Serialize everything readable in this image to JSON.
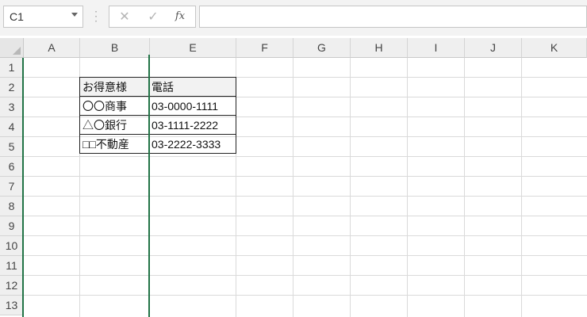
{
  "formula_bar": {
    "name_box": "C1",
    "cancel_icon": "✕",
    "enter_icon": "✓",
    "fx_label": "fx",
    "formula": ""
  },
  "columns": [
    "A",
    "B",
    "E",
    "F",
    "G",
    "H",
    "I",
    "J",
    "K"
  ],
  "rows": [
    "1",
    "2",
    "3",
    "4",
    "5",
    "6",
    "7",
    "8",
    "9",
    "10",
    "11",
    "12",
    "13"
  ],
  "table": {
    "header": [
      "お得意様",
      "電話"
    ],
    "rows": [
      [
        "〇〇商事",
        "03-0000-1111"
      ],
      [
        "△〇銀行",
        "03-1111-2222"
      ],
      [
        "□□不動産",
        "03-2222-3333"
      ]
    ]
  },
  "colors": {
    "accent": "#217346",
    "header_fill": "#efefef"
  }
}
